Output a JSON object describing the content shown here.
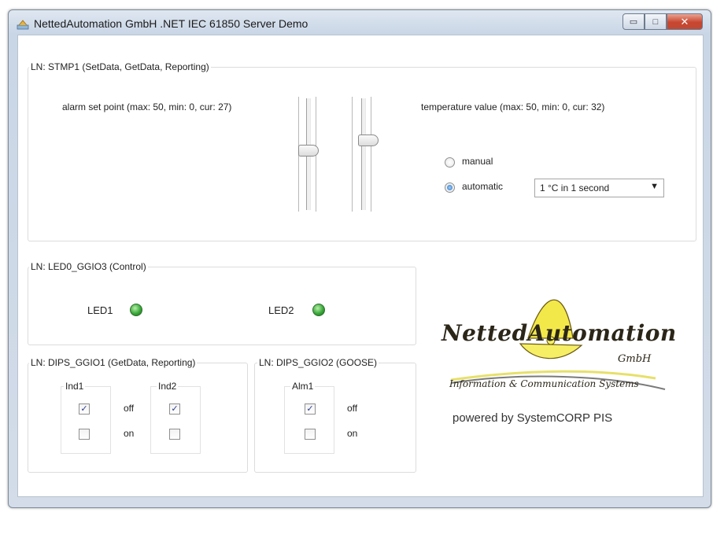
{
  "window": {
    "title": "NettedAutomation GmbH .NET IEC 61850 Server Demo",
    "buttons": {
      "minimize": "▭",
      "maximize": "□",
      "close": "✕"
    }
  },
  "stmp": {
    "group_label": "LN: STMP1 (SetData, GetData, Reporting)",
    "alarm_label": "alarm set point (max: 50, min: 0, cur: 27)",
    "alarm": {
      "max": 50,
      "min": 0,
      "cur": 27
    },
    "temp_label": "temperature value (max: 50, min: 0, cur: 32)",
    "temp": {
      "max": 50,
      "min": 0,
      "cur": 32
    },
    "radio_manual": "manual",
    "radio_automatic": "automatic",
    "selected_mode": "automatic",
    "rate_select_value": "1 °C in 1 second"
  },
  "led_group": {
    "group_label": "LN: LED0_GGIO3 (Control)",
    "led1_label": "LED1",
    "led2_label": "LED2",
    "led_color": "#3aa83a"
  },
  "dips1": {
    "group_label": "LN: DIPS_GGIO1 (GetData, Reporting)",
    "ind1_label": "Ind1",
    "ind2_label": "Ind2",
    "off_label": "off",
    "on_label": "on",
    "ind1": {
      "off_checked": true,
      "on_checked": false
    },
    "ind2": {
      "off_checked": true,
      "on_checked": false
    }
  },
  "dips2": {
    "group_label": "LN: DIPS_GGIO2 (GOOSE)",
    "alm1_label": "Alm1",
    "off_label": "off",
    "on_label": "on",
    "alm1": {
      "off_checked": true,
      "on_checked": false
    }
  },
  "branding": {
    "logo_text": "NettedAutomation",
    "logo_gmbh": "GmbH",
    "logo_tagline": "Information & Communication Systems",
    "powered_by": "powered by SystemCORP PIS"
  }
}
